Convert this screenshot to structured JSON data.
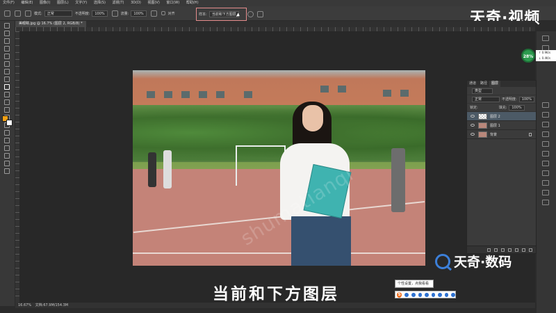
{
  "menubar": {
    "items": [
      "文件(F)",
      "编辑(E)",
      "图像(I)",
      "图层(L)",
      "文字(Y)",
      "选择(S)",
      "滤镜(T)",
      "3D(D)",
      "视图(V)",
      "窗口(W)",
      "帮助(H)"
    ]
  },
  "options": {
    "mode_label": "模式:",
    "mode_value": "正常",
    "opacity_label": "不透明度:",
    "opacity_value": "100%",
    "flow_label": "流量:",
    "flow_value": "100%",
    "align_label": "对齐",
    "sample_label": "样本:",
    "sample_value": "当前和下方图层"
  },
  "document": {
    "tab_title": "美眼睛.jpg @ 16.7% (图层 2, RGB/8) *"
  },
  "status": {
    "zoom": "16.67%",
    "doc": "文档:67.9M/154.3M"
  },
  "layers_panel": {
    "tabs": [
      "通道",
      "路径",
      "图层"
    ],
    "active_tab": "图层",
    "filter_value": "类型",
    "blend_mode": "正常",
    "opacity_label": "不透明度:",
    "opacity_value": "100%",
    "lock_label": "锁定:",
    "fill_label": "填充:",
    "fill_value": "100%",
    "layers": [
      {
        "name": "图层 2",
        "selected": true
      },
      {
        "name": "图层 1",
        "selected": false
      },
      {
        "name": "背景",
        "selected": false
      }
    ]
  },
  "overlay": {
    "logo_top": "天奇·视频",
    "logo_bottom": "天奇·数码",
    "subtitle": "当前和下方图层",
    "watermark": "shumatianqi",
    "tooltip": "个性设置，点我看看",
    "cpu_percent": "28%",
    "net_up": "↑ 0.9K/s",
    "net_down": "↓ 0.4K/s",
    "ime_logo": "S"
  },
  "colors": {
    "foreground": "#f1a014",
    "background": "#ffffff",
    "accent_green": "#2c9b4e",
    "logo_blue": "#3c7fd8"
  }
}
